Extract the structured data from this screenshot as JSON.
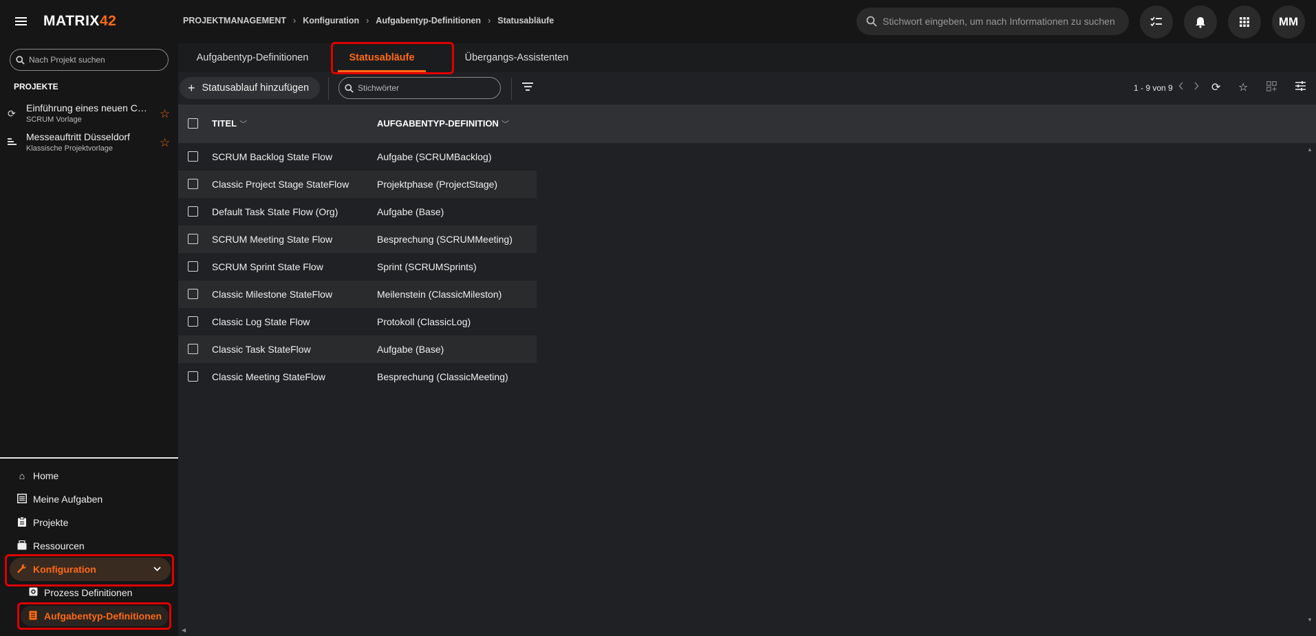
{
  "app": {
    "logo_main": "MATRIX",
    "logo_accent": "42"
  },
  "breadcrumb": [
    "PROJEKTMANAGEMENT",
    "Konfiguration",
    "Aufgabentyp-Definitionen",
    "Statusabläufe"
  ],
  "global_search": {
    "placeholder": "Stichwort eingeben, um nach Informationen zu suchen"
  },
  "user": {
    "initials": "MM"
  },
  "sidebar": {
    "search_placeholder": "Nach Projekt suchen",
    "projects_heading": "PROJEKTE",
    "projects": [
      {
        "title": "Einführung eines neuen CR...",
        "subtitle": "SCRUM Vorlage",
        "icon": "sync-icon"
      },
      {
        "title": "Messeauftritt Düsseldorf",
        "subtitle": "Klassische Projektvorlage",
        "icon": "gantt-icon"
      }
    ],
    "nav": [
      {
        "label": "Home",
        "icon": "home-icon"
      },
      {
        "label": "Meine Aufgaben",
        "icon": "tasks-icon"
      },
      {
        "label": "Projekte",
        "icon": "clipboard-icon"
      },
      {
        "label": "Ressourcen",
        "icon": "resources-icon"
      },
      {
        "label": "Konfiguration",
        "icon": "wrench-icon",
        "active": true
      }
    ],
    "subnav": [
      {
        "label": "Prozess Definitionen",
        "icon": "process-icon"
      },
      {
        "label": "Aufgabentyp-Definitionen",
        "icon": "definition-icon",
        "active": true
      }
    ]
  },
  "tabs": [
    {
      "label": "Aufgabentyp-Definitionen"
    },
    {
      "label": "Statusabläufe",
      "active": true
    },
    {
      "label": "Übergangs-Assistenten"
    }
  ],
  "toolbar": {
    "add_label": "Statusablauf hinzufügen",
    "keyword_placeholder": "Stichwörter",
    "pager": "1 - 9 von 9"
  },
  "table": {
    "columns": [
      "TITEL",
      "AUFGABENTYP-DEFINITION"
    ],
    "rows": [
      [
        "SCRUM Backlog State Flow",
        "Aufgabe (SCRUMBacklog)"
      ],
      [
        "Classic Project Stage StateFlow",
        "Projektphase (ProjectStage)"
      ],
      [
        "Default Task State Flow (Org)",
        "Aufgabe (Base)"
      ],
      [
        "SCRUM Meeting State Flow",
        "Besprechung (SCRUMMeeting)"
      ],
      [
        "SCRUM Sprint State Flow",
        "Sprint (SCRUMSprints)"
      ],
      [
        "Classic Milestone StateFlow",
        "Meilenstein (ClassicMileston)"
      ],
      [
        "Classic Log State Flow",
        "Protokoll (ClassicLog)"
      ],
      [
        "Classic Task StateFlow",
        "Aufgabe (Base)"
      ],
      [
        "Classic Meeting StateFlow",
        "Besprechung (ClassicMeeting)"
      ]
    ]
  },
  "colors": {
    "accent": "#ff6a13",
    "highlight": "#e00000",
    "background": "#202124",
    "sidebar": "#161616"
  }
}
